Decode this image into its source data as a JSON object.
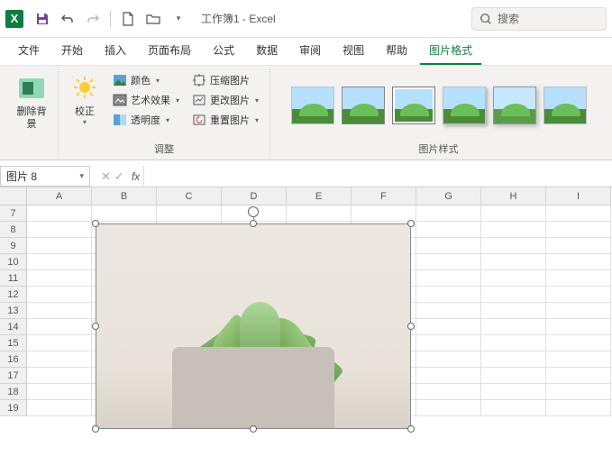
{
  "titlebar": {
    "title": "工作簿1 - Excel",
    "search_placeholder": "搜索"
  },
  "tabs": [
    "文件",
    "开始",
    "插入",
    "页面布局",
    "公式",
    "数据",
    "审阅",
    "视图",
    "帮助",
    "图片格式"
  ],
  "active_tab_index": 9,
  "ribbon": {
    "remove_bg": "删除背景",
    "corrections": "校正",
    "color": "颜色",
    "artistic": "艺术效果",
    "transparency": "透明度",
    "adjust_label": "调整",
    "compress": "压缩图片",
    "change": "更改图片",
    "reset": "重置图片",
    "styles_label": "图片样式"
  },
  "namebox": "图片 8",
  "fx": "fx",
  "columns": [
    "A",
    "B",
    "C",
    "D",
    "E",
    "F",
    "G",
    "H",
    "I"
  ],
  "rows": [
    "7",
    "8",
    "9",
    "10",
    "11",
    "12",
    "13",
    "14",
    "15",
    "16",
    "17",
    "18",
    "19"
  ]
}
